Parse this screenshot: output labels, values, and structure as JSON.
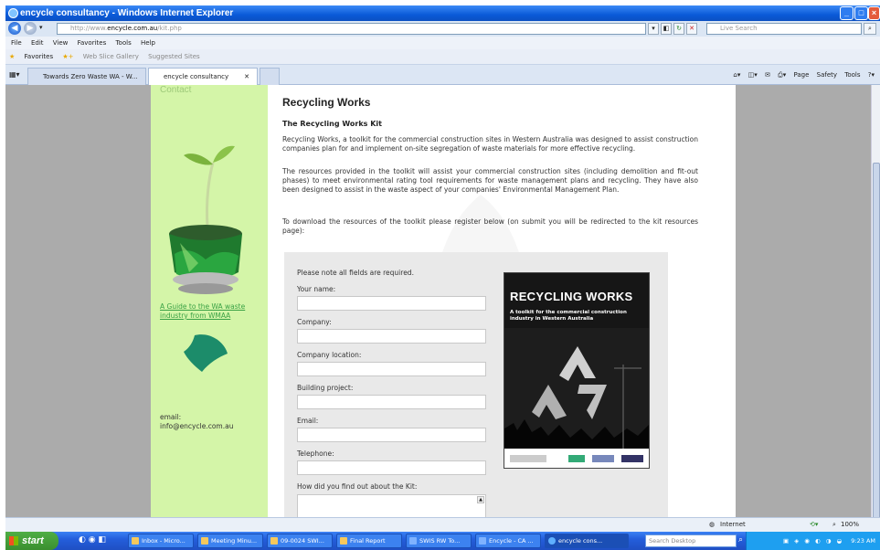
{
  "window": {
    "title": "encycle consultancy - Windows Internet Explorer"
  },
  "address": {
    "url_prefix": "http://www.",
    "url_domain": "encycle.com.au",
    "url_path": "/kit.php",
    "search_placeholder": "Live Search"
  },
  "menu": {
    "items": [
      "File",
      "Edit",
      "View",
      "Favorites",
      "Tools",
      "Help"
    ]
  },
  "favorites": {
    "label": "Favorites",
    "web_slice": "Web Slice Gallery",
    "suggested": "Suggested Sites"
  },
  "tabs": [
    {
      "label": "Towards Zero Waste WA - W..."
    },
    {
      "label": "encycle consultancy"
    }
  ],
  "command_bar": {
    "page": "Page",
    "safety": "Safety",
    "tools": "Tools"
  },
  "sidebar": {
    "contact_label": "Contact",
    "wmaa_link": "A Guide to the WA waste industry from WMAA",
    "email_label": "email:",
    "email_value": "info@encycle.com.au"
  },
  "main": {
    "heading": "Recycling Works",
    "subheading": "The Recycling Works Kit",
    "para1": "Recycling Works, a toolkit for the commercial construction sites in Western Australia was designed to assist construction companies plan for and implement on-site segregation of waste materials for more effective recycling.",
    "para2": "The resources provided in the toolkit will assist your commercial construction sites (including demolition and fit-out phases) to meet environmental rating tool requirements for waste management plans and recycling. They have also been designed to assist in the waste aspect of your companies' Environmental Management Plan.",
    "para3": "To download the resources of the toolkit please register below (on submit you will be redirected to the kit resources page):"
  },
  "form": {
    "note": "Please note all fields are required.",
    "name_label": "Your name:",
    "company_label": "Company:",
    "location_label": "Company location:",
    "project_label": "Building project:",
    "email_label": "Email:",
    "phone_label": "Telephone:",
    "howfind_label": "How did you find out about the Kit:"
  },
  "cover": {
    "title": "RECYCLING WORKS",
    "subtitle": "A toolkit for the commercial construction industry in Western Australia"
  },
  "status": {
    "zone": "Internet",
    "zoom": "100%"
  },
  "taskbar": {
    "start": "start",
    "items": [
      "Inbox - Micro...",
      "Meeting Minu...",
      "09-0024 SWI...",
      "Final Report",
      "SWIS RW To...",
      "Encycle - CA ...",
      "encycle cons..."
    ],
    "desktop_search": "Search Desktop",
    "clock": "9:23 AM"
  },
  "colors": {
    "sidebar_bg": "#d4f5a8",
    "link_green": "#3aa245",
    "form_bg": "#e9e9e9",
    "titlebar": "#0a5ad8"
  }
}
